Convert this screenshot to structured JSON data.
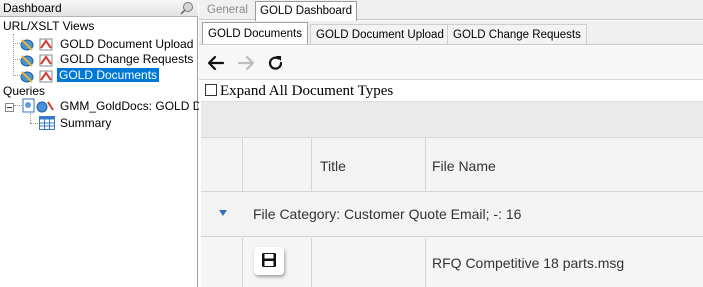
{
  "left_panel": {
    "title": "Dashboard",
    "views_group_label": "URL/XSLT Views",
    "views": [
      {
        "label": "GOLD Document Upload"
      },
      {
        "label": "GOLD Change Requests"
      },
      {
        "label": "GOLD Documents",
        "selected": true
      }
    ],
    "queries_group_label": "Queries",
    "query_node_label": "GMM_GoldDocs: GOLD D",
    "summary_label": "Summary"
  },
  "outer_tabs": [
    {
      "label": "General",
      "active": false
    },
    {
      "label": "GOLD Dashboard",
      "active": true
    }
  ],
  "inner_tabs": [
    {
      "label": "GOLD Documents",
      "active": true
    },
    {
      "label": "GOLD Document Upload",
      "active": false
    },
    {
      "label": "GOLD Change Requests",
      "active": false
    }
  ],
  "toolbar": {
    "back_icon": "arrow-left-icon",
    "forward_icon": "arrow-right-icon",
    "refresh_icon": "refresh-icon"
  },
  "expand_all": {
    "label": "Expand All Document Types",
    "checked": false
  },
  "grid": {
    "columns": [
      "Title",
      "File Name"
    ],
    "group_label": "File Category: Customer Quote Email; -: 16",
    "rows": [
      {
        "file_name": "RFQ Competitive 18 parts.msg"
      }
    ]
  },
  "colors": {
    "selection": "#0078d7",
    "caret": "#2f6fb5",
    "grid_background": "#f5f5f5"
  }
}
